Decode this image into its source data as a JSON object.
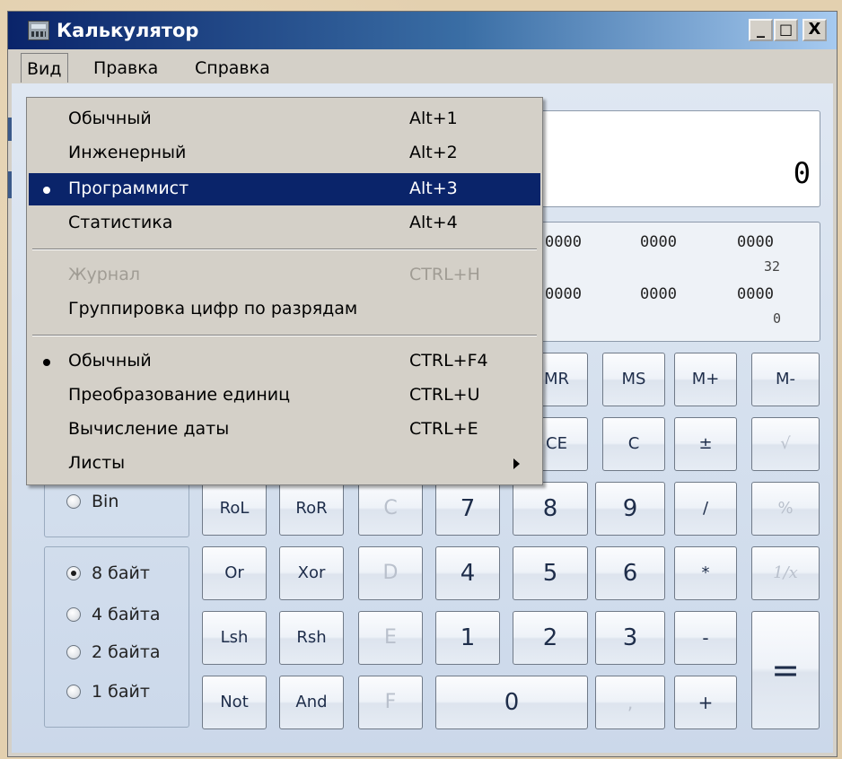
{
  "window": {
    "title": "Калькулятор",
    "min_icon": "minimize-icon",
    "max_icon": "maximize-icon",
    "close_icon": "close-icon",
    "min_glyph": "_",
    "max_glyph": "□",
    "close_glyph": "X"
  },
  "menubar": {
    "items": [
      "Вид",
      "Правка",
      "Справка"
    ]
  },
  "dropdown": {
    "groups": [
      [
        {
          "label": "Обычный",
          "shortcut": "Alt+1",
          "bullet": false,
          "highlighted": false,
          "disabled": false
        },
        {
          "label": "Инженерный",
          "shortcut": "Alt+2",
          "bullet": false,
          "highlighted": false,
          "disabled": false
        },
        {
          "label": "Программист",
          "shortcut": "Alt+3",
          "bullet": true,
          "highlighted": true,
          "disabled": false
        },
        {
          "label": "Статистика",
          "shortcut": "Alt+4",
          "bullet": false,
          "highlighted": false,
          "disabled": false
        }
      ],
      [
        {
          "label": "Журнал",
          "shortcut": "CTRL+H",
          "bullet": false,
          "highlighted": false,
          "disabled": true
        },
        {
          "label": "Группировка цифр по разрядам",
          "shortcut": "",
          "bullet": false,
          "highlighted": false,
          "disabled": false
        }
      ],
      [
        {
          "label": "Обычный",
          "shortcut": "CTRL+F4",
          "bullet": true,
          "highlighted": false,
          "disabled": false
        },
        {
          "label": "Преобразование единиц",
          "shortcut": "CTRL+U",
          "bullet": false,
          "highlighted": false,
          "disabled": false
        },
        {
          "label": "Вычисление даты",
          "shortcut": "CTRL+E",
          "bullet": false,
          "highlighted": false,
          "disabled": false
        },
        {
          "label": "Листы",
          "shortcut": "",
          "bullet": false,
          "highlighted": false,
          "disabled": false,
          "submenu": true
        }
      ]
    ]
  },
  "display": {
    "value": "0",
    "bits_row1": [
      "0000",
      "0000",
      "0000"
    ],
    "bits_pos1": "32",
    "bits_row2": [
      "0000",
      "0000",
      "0000"
    ],
    "bits_pos2": "0"
  },
  "word_size": {
    "bin_label": "Bin",
    "options": [
      {
        "label": "8 байт",
        "selected": true
      },
      {
        "label": "4 байта",
        "selected": false
      },
      {
        "label": "2 байта",
        "selected": false
      },
      {
        "label": "1 байт",
        "selected": false
      }
    ]
  },
  "buttons": {
    "mr": "MR",
    "ms": "MS",
    "mplus": "M+",
    "mminus": "M-",
    "ce": "CE",
    "c": "C",
    "plusminus": "±",
    "sqrt": "√",
    "rol": "RoL",
    "ror": "RoR",
    "hexC": "C",
    "n7": "7",
    "n8": "8",
    "n9": "9",
    "div": "/",
    "pct": "%",
    "or": "Or",
    "xor": "Xor",
    "hexD": "D",
    "n4": "4",
    "n5": "5",
    "n6": "6",
    "mul": "*",
    "recip": "1/x",
    "lsh": "Lsh",
    "rsh": "Rsh",
    "hexE": "E",
    "n1": "1",
    "n2": "2",
    "n3": "3",
    "minus": "-",
    "eq": "=",
    "not": "Not",
    "and": "And",
    "hexF": "F",
    "n0": "0",
    "dot": ",",
    "plus": "+"
  }
}
